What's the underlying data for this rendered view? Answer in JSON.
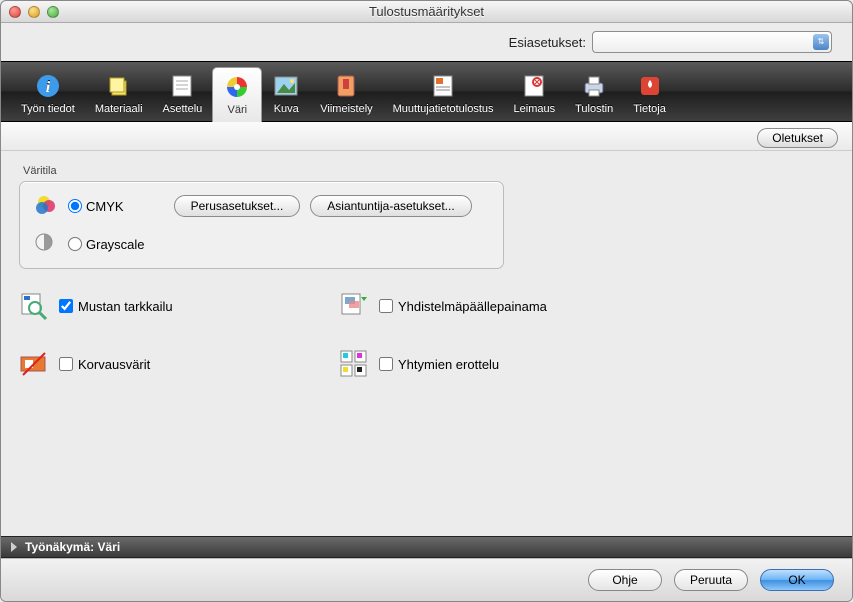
{
  "window": {
    "title": "Tulostusmääritykset"
  },
  "preset": {
    "label": "Esiasetukset:"
  },
  "tabs": [
    {
      "label": "Työn tiedot"
    },
    {
      "label": "Materiaali"
    },
    {
      "label": "Asettelu"
    },
    {
      "label": "Väri"
    },
    {
      "label": "Kuva"
    },
    {
      "label": "Viimeistely"
    },
    {
      "label": "Muuttujatietotulostus"
    },
    {
      "label": "Leimaus"
    },
    {
      "label": "Tulostin"
    },
    {
      "label": "Tietoja"
    }
  ],
  "defaults_button": "Oletukset",
  "color_group": {
    "title": "Väritila",
    "cmyk": "CMYK",
    "grayscale": "Grayscale",
    "basic_btn": "Perusasetukset...",
    "expert_btn": "Asiantuntija-asetukset..."
  },
  "checks": {
    "black_monitor": "Mustan tarkkailu",
    "substitute": "Korvausvärit",
    "combo_overprint": "Yhdistelmäpäällepainama",
    "separation": "Yhtymien erottelu"
  },
  "footer": {
    "label": "Työnäkymä: Väri"
  },
  "buttons": {
    "help": "Ohje",
    "cancel": "Peruuta",
    "ok": "OK"
  }
}
